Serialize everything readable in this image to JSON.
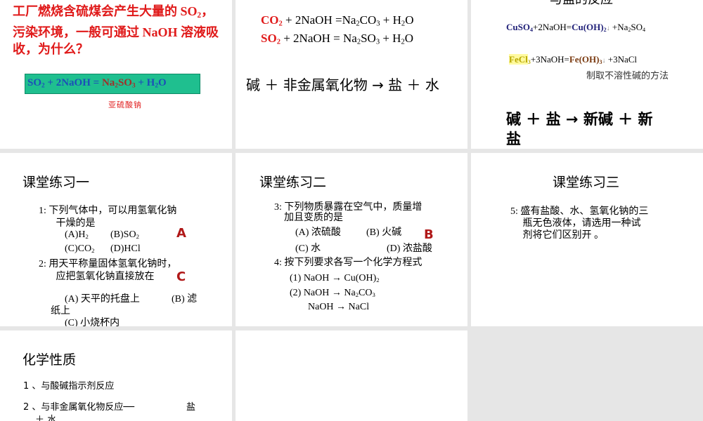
{
  "slides": [
    {
      "q_line1": "工厂燃烧含硫煤会产生大量的 SO",
      "q_sub": "2",
      "q_line1_end": "，",
      "q_line2": "污染环境，一般可通过 NaOH 溶液吸",
      "q_line3": "收，为什么？",
      "eq": {
        "a": "SO",
        "a_sub": "2",
        "b": " + 2NaOH = ",
        "c": "Na",
        "c_sub": "2",
        "c2": "SO",
        "c_sub2": "3",
        "d": " + H",
        "d_sub": "2",
        "e": "O"
      },
      "note": "亚硫酸钠",
      "colors": {
        "eq_bg": "#1fbf8f",
        "blue": "#1c4fb8",
        "brown": "#a0302a"
      }
    },
    {
      "eq1": {
        "a": "CO",
        "a_sub": "2",
        "b": " + 2NaOH =Na",
        "b_sub": "2",
        "c": "CO",
        "c_sub": "3",
        "d": " + H",
        "d_sub": "2",
        "e": "O"
      },
      "eq2": {
        "a": "SO",
        "a_sub": "2",
        "b": " + 2NaOH = Na",
        "b_sub": "2",
        "c": "SO",
        "c_sub": "3",
        "d": " + H",
        "d_sub": "2",
        "e": "O"
      },
      "rule": "碱  ＋ 非金属氧化物  →  盐  ＋ 水"
    },
    {
      "title_partial": "与盐的反应",
      "eq1": {
        "a": "CuSO",
        "a_sub": "4",
        "b": "+2NaOH=",
        "c": "Cu(OH)",
        "c_sub": "2",
        "d": "  +Na",
        "d_sub": "2",
        "e": "SO",
        "e_sub": "4"
      },
      "eq2": {
        "a": "FeCl",
        "a_sub": "3",
        "b": "+3NaOH=",
        "c": "Fe(OH)",
        "c_sub": "3",
        "d": "  +3NaCl"
      },
      "note": "制取不溶性碱的方法",
      "rule1": "碱  ＋ 盐  →  新碱  ＋ 新",
      "rule2": "盐"
    },
    {
      "title": "课堂练习一",
      "q1a": "1: 下列气体中，可以用氢氧化钠",
      "q1b": "干燥的是",
      "opts1": {
        "a": "(A)H",
        "a_sub": "2",
        "b": "(B)SO",
        "b_sub": "2",
        "c": "(C)CO",
        "c_sub": "2",
        "d": "(D)HCl"
      },
      "ans1": "A",
      "q2a": "2: 用天平称量固体氢氧化钠时，",
      "q2b": "应把氢氧化钠直接放在",
      "ans2": "C",
      "opt2a": "(A) 天平的托盘上",
      "opt2b": "(B) 滤",
      "opt2b2": "纸上",
      "opt2c": "(C) 小烧杯内"
    },
    {
      "title": "课堂练习二",
      "q3a": "3: 下列物质暴露在空气中，质量增",
      "q3b": "加且变质的是",
      "opts": [
        "(A) 浓硫酸",
        "(B) 火碱",
        "(C) 水",
        "(D) 浓盐酸"
      ],
      "ans": "B",
      "q4": "4: 按下列要求各写一个化学方程式",
      "e1": {
        "a": "(1)  NaOH → Cu(OH)",
        "a_sub": "2"
      },
      "e2": {
        "a": "(2)  NaOH → Na",
        "a_sub": "2",
        "b": "CO",
        "b_sub": "3"
      },
      "e3": "NaOH → NaCl"
    },
    {
      "title": "课堂练习三",
      "q5a": "5: 盛有盐酸、水、氢氧化钠的三",
      "q5b": "瓶无色液体，请选用一种试",
      "q5c": "剂将它们区别开 。"
    },
    {
      "title": "化学性质",
      "l1": "1 、与酸碱指示剂反应",
      "l2": "2 、与非金属氧化物反应──",
      "l2b": "盐",
      "l3": "＋ 水"
    },
    {}
  ]
}
